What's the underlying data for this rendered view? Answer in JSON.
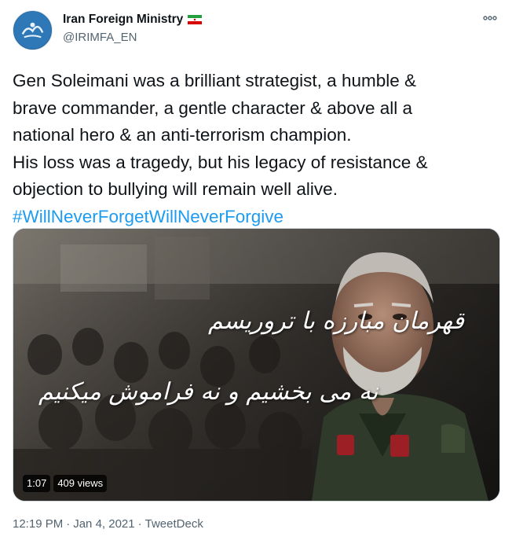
{
  "account": {
    "display_name": "Iran Foreign Ministry",
    "handle": "@IRIMFA_EN",
    "verified_flag_icon": "iran-flag-icon"
  },
  "tweet": {
    "lines": [
      "Gen Soleimani was a brilliant strategist, a humble &",
      "brave commander, a gentle character & above all a",
      "national hero & an anti-terrorism champion.",
      "His loss was a tragedy, but his legacy of resistance &",
      "objection to bullying will remain well alive."
    ],
    "hashtag": "#WillNeverForgetWillNeverForgive"
  },
  "media": {
    "overlay_line_1": "قهرمان مبارزه با تروریسم",
    "overlay_line_2": "نه می بخشیم و نه فراموش میکنیم",
    "duration": "1:07",
    "views": "409 views"
  },
  "meta": {
    "time": "12:19 PM",
    "separator": "·",
    "date": "Jan 4, 2021",
    "source": "TweetDeck"
  },
  "colors": {
    "link": "#1d9bf0",
    "secondary_text": "#536471",
    "primary_text": "#0f1419"
  }
}
